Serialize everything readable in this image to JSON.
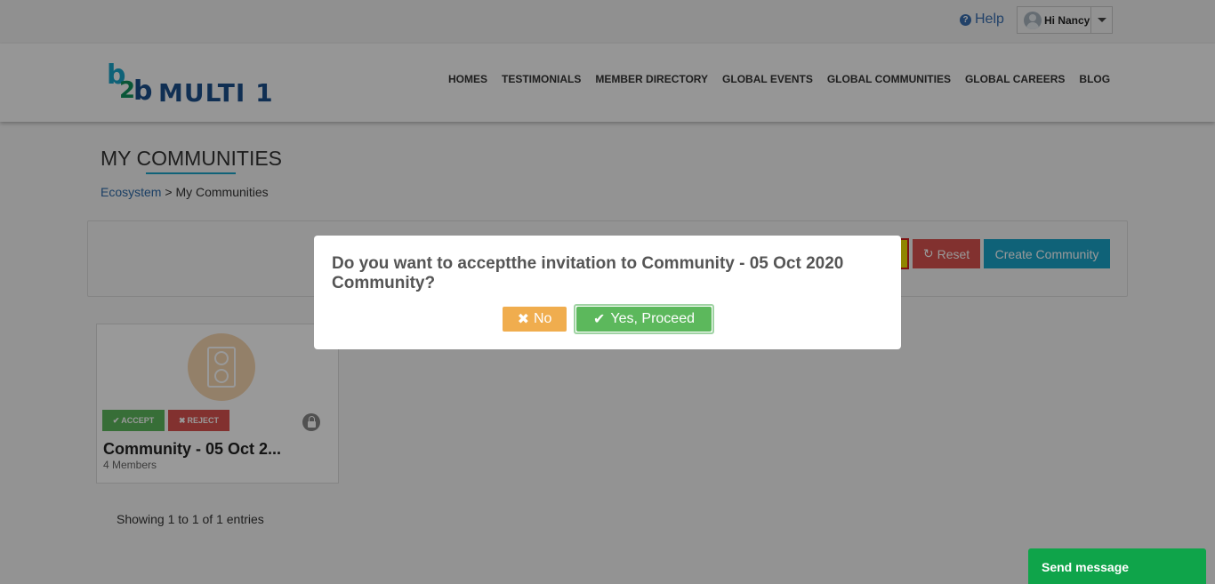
{
  "topbar": {
    "help_label": "Help",
    "help_icon": "question-circle-icon",
    "user_label": "Hi Nancy"
  },
  "header": {
    "logo_mark": "b2b",
    "logo_name": "MULTI 1",
    "nav": [
      "HOMES",
      "TESTIMONIALS",
      "MEMBER DIRECTORY",
      "GLOBAL EVENTS",
      "GLOBAL COMMUNITIES",
      "GLOBAL CAREERS",
      "BLOG"
    ]
  },
  "page": {
    "title": "MY COMMUNITIES",
    "breadcrumb_link": "Ecosystem",
    "breadcrumb_sep": " > ",
    "breadcrumb_current": "My Communities"
  },
  "filter": {
    "reset_label": "Reset",
    "create_label": "Create Community"
  },
  "card": {
    "accept_label": "ACCEPT",
    "reject_label": "REJECT",
    "name": "Community - 05 Oct 2...",
    "members": "4 Members"
  },
  "footer": {
    "showing": "Showing 1 to 1 of 1 entries"
  },
  "chat": {
    "send_label": "Send message"
  },
  "modal": {
    "message": "Do you want to acceptthe invitation to Community - 05 Oct 2020 Community?",
    "no_label": "No",
    "yes_label": "Yes, Proceed"
  },
  "colors": {
    "accent": "#1aa3c9",
    "success": "#5cb85c",
    "danger": "#d9534f",
    "warning": "#f0ad4e",
    "chat": "#0fa44a"
  }
}
